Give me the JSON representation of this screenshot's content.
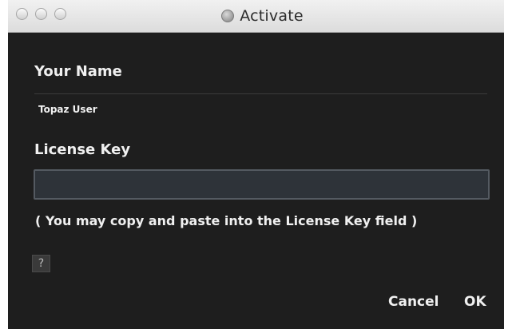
{
  "window": {
    "title": "Activate",
    "app_icon": "topaz-globe-icon"
  },
  "form": {
    "name_label": "Your Name",
    "name_value": "Topaz User",
    "key_label": "License Key",
    "key_value": "",
    "hint": "( You may copy and paste into the License Key field )"
  },
  "buttons": {
    "help": "?",
    "cancel": "Cancel",
    "ok": "OK"
  },
  "colors": {
    "background": "#1e1e1e",
    "text": "#f0f0f0",
    "field": "#2e3339"
  }
}
